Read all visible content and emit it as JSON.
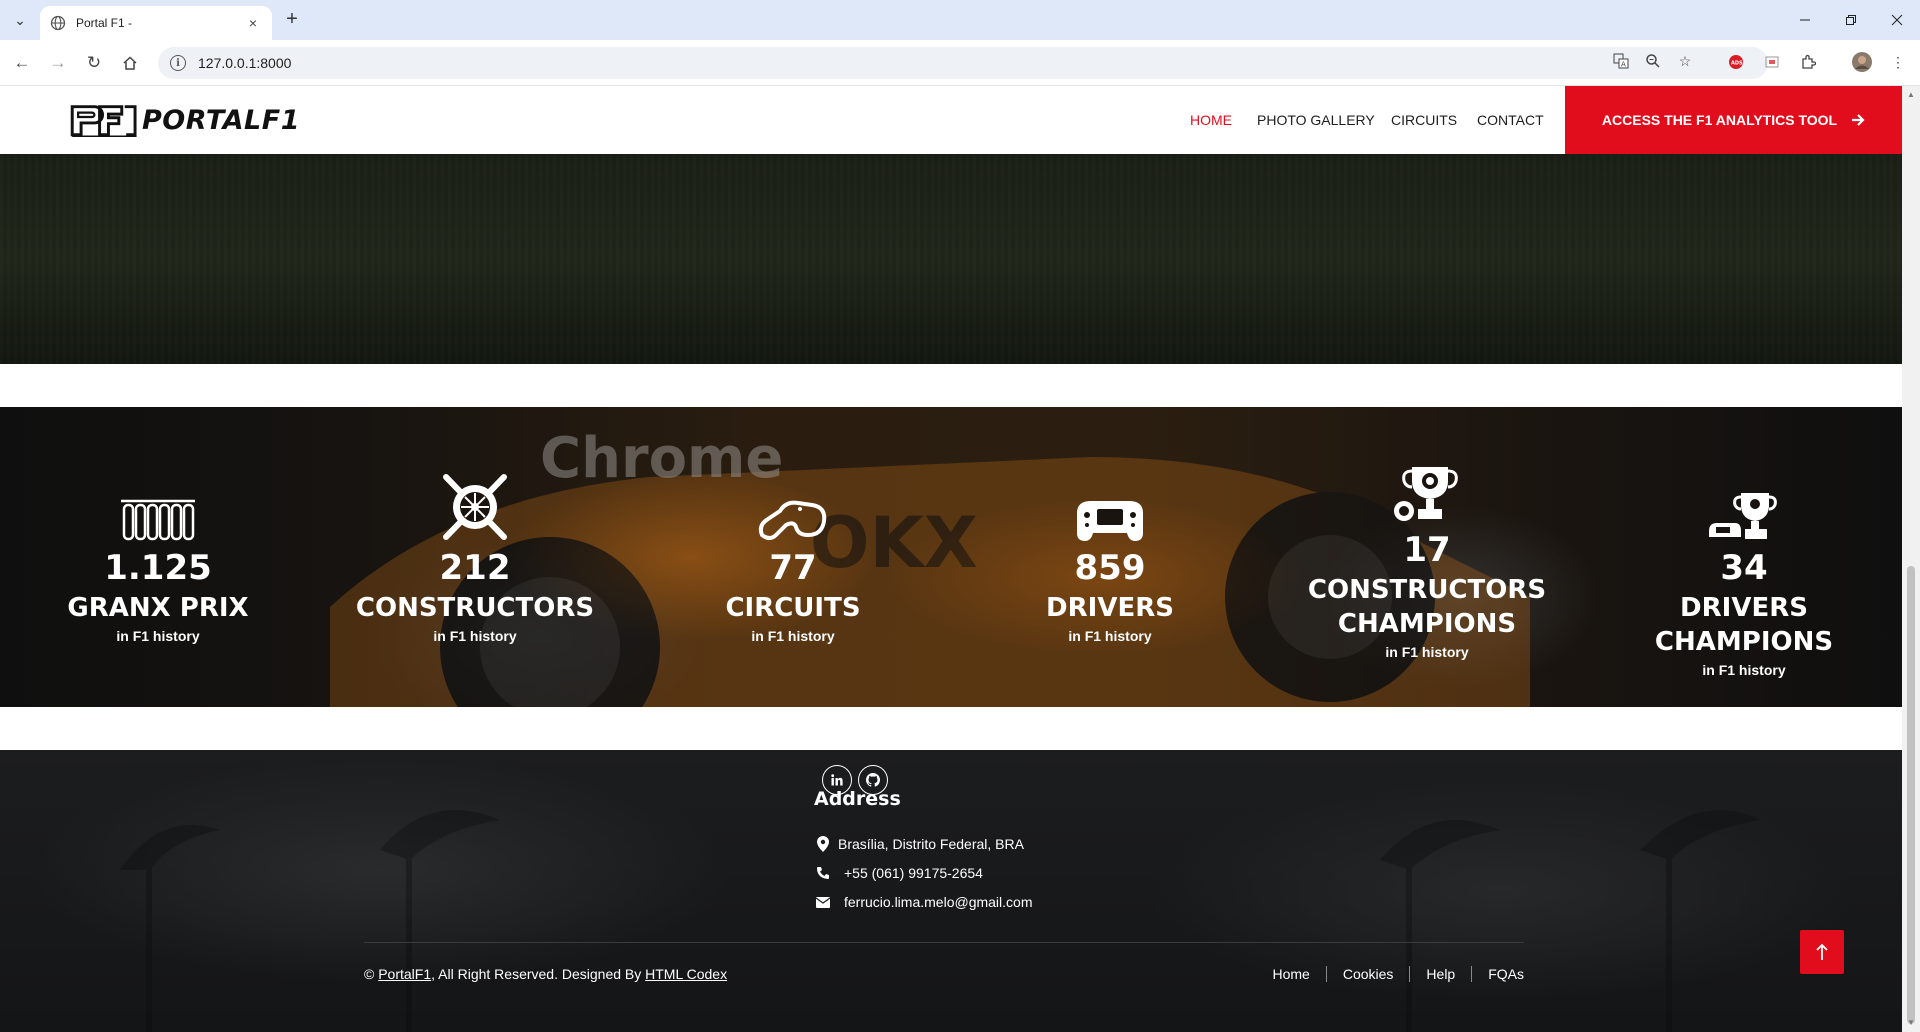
{
  "browser": {
    "tab_title": "Portal F1 -",
    "url": "127.0.0.1:8000",
    "new_tab_symbol": "+",
    "close_symbol": "×"
  },
  "navbar": {
    "logo_text": "PORTALF1",
    "menu": [
      {
        "label": "HOME",
        "active": true
      },
      {
        "label": "PHOTO GALLERY",
        "active": false
      },
      {
        "label": "CIRCUITS",
        "active": false
      },
      {
        "label": "CONTACT",
        "active": false
      }
    ],
    "cta_label": "ACCESS THE F1 ANALYTICS TOOL",
    "accent_color": "#e20d1c"
  },
  "stats": [
    {
      "icon": "grid-icon",
      "number": "1.125",
      "label": "GRANX PRIX",
      "sub": "in F1 history"
    },
    {
      "icon": "wheel-wrench-icon",
      "number": "212",
      "label": "CONSTRUCTORS",
      "sub": "in F1 history"
    },
    {
      "icon": "circuit-track-icon",
      "number": "77",
      "label": "CIRCUITS",
      "sub": "in F1 history"
    },
    {
      "icon": "steering-wheel-icon",
      "number": "859",
      "label": "DRIVERS",
      "sub": "in F1 history"
    },
    {
      "icon": "trophy-wheel-icon",
      "number": "17",
      "label_line1": "CONSTRUCTORS",
      "label_line2": "CHAMPIONS",
      "sub": "in F1 history"
    },
    {
      "icon": "trophy-car-icon",
      "number": "34",
      "label": "DRIVERS CHAMPIONS",
      "sub": "in F1 history"
    }
  ],
  "footer": {
    "address_title": "Address",
    "location": "Brasília, Distrito Federal, BRA",
    "phone": "+55 (061) 99175-2654",
    "email": "ferrucio.lima.melo@gmail.com",
    "copyright_prefix": "©",
    "site_name": "PortalF1",
    "copyright_mid": ", All Right Reserved. Designed By",
    "designer": "HTML Codex",
    "links": [
      "Home",
      "Cookies",
      "Help",
      "FQAs"
    ]
  }
}
